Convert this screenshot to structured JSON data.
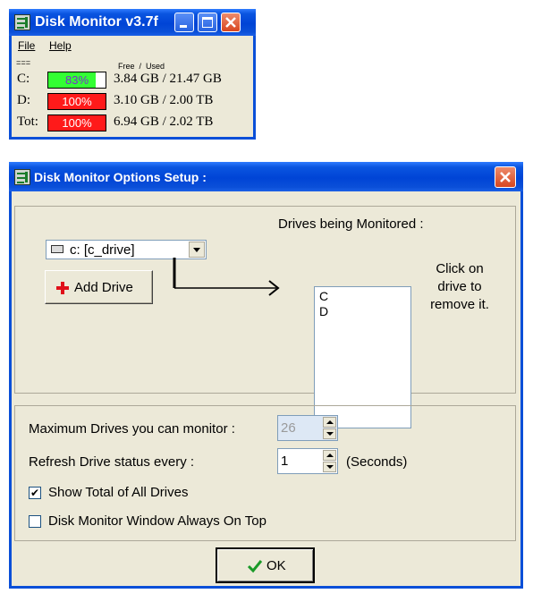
{
  "mini_window": {
    "title": "Disk Monitor v3.7f",
    "menu": [
      "File",
      "Help"
    ],
    "separator": "===",
    "header": "Free  /  Used",
    "rows": [
      {
        "label": "C:",
        "percent_text": "83%",
        "percent": 83,
        "bar_color": "#33ff33",
        "sizes": "3.84 GB / 21.47 GB"
      },
      {
        "label": "D:",
        "percent_text": "100%",
        "percent": 100,
        "bar_color": "#ff1a1a",
        "sizes": "3.10 GB / 2.00 TB"
      },
      {
        "label": "Tot:",
        "percent_text": "100%",
        "percent": 100,
        "bar_color": "#ff1a1a",
        "sizes": "6.94 GB / 2.02 TB"
      }
    ]
  },
  "options_dialog": {
    "title": "Disk Monitor Options Setup :",
    "drive_select_value": "c: [c_drive]",
    "add_drive_label": "Add Drive",
    "monitored_header": "Drives being Monitored :",
    "monitored_drives": [
      "C",
      "D"
    ],
    "hint_lines": [
      "Click on",
      "drive to",
      "remove it."
    ],
    "max_drives_label": "Maximum Drives you can monitor :",
    "max_drives_value": "26",
    "refresh_label": "Refresh Drive status every :",
    "refresh_value": "1",
    "refresh_unit": "(Seconds)",
    "show_total_label": "Show Total of All Drives",
    "show_total_checked": true,
    "always_on_top_label": "Disk Monitor Window Always On Top",
    "always_on_top_checked": false,
    "ok_label": "OK"
  }
}
